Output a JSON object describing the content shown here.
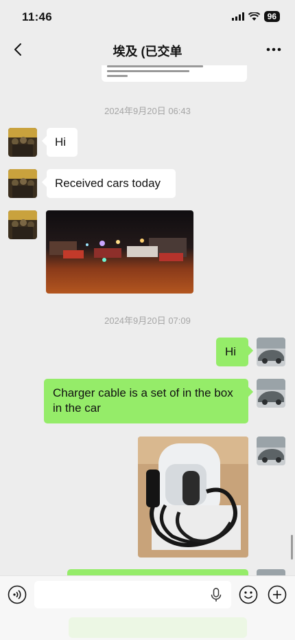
{
  "status_bar": {
    "time": "11:46",
    "battery": "96"
  },
  "nav": {
    "title": "埃及 (已交单"
  },
  "colors": {
    "bubble_out": "#95ec69",
    "bubble_in": "#ffffff",
    "background": "#ededed"
  },
  "messages": {
    "timestamp_1": "2024年9月20日 06:43",
    "in_1": "Hi",
    "in_2": "Received cars today",
    "timestamp_2": "2024年9月20日 07:09",
    "out_1": "Hi",
    "out_2": "Charger cable is a set of in the box in the car"
  },
  "input": {
    "placeholder": ""
  }
}
